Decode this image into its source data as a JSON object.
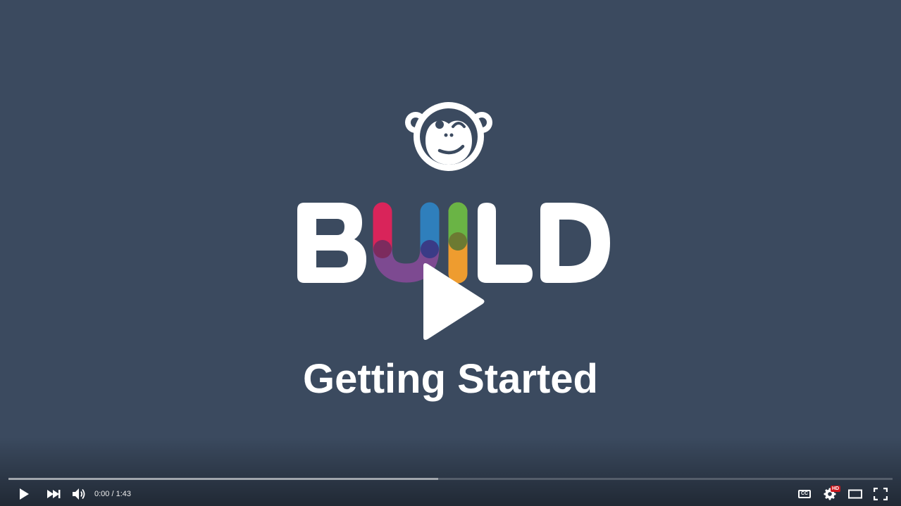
{
  "video": {
    "title_card": "Getting Started",
    "logo_word": "BUILD"
  },
  "colors": {
    "background": "#3b4a5f",
    "logo_white": "#ffffff",
    "bar_red": "#d9245a",
    "bar_blue": "#2f7fbc",
    "bar_green": "#6ab445",
    "u_purple": "#7d4a91",
    "i_orange": "#ee9c2f",
    "progress_played": "#cc181e"
  },
  "player": {
    "progress_fraction": 0.0,
    "buffered_fraction": 0.486,
    "time_display": "0:00 / 1:43",
    "hd_badge": "HD",
    "cc_label": "CC"
  },
  "icons": {
    "big_play": "play-icon",
    "play": "play-icon",
    "next": "skip-next-icon",
    "volume": "volume-icon",
    "captions": "closed-captions-icon",
    "settings": "gear-icon",
    "theater": "theater-mode-icon",
    "fullscreen": "fullscreen-icon"
  }
}
